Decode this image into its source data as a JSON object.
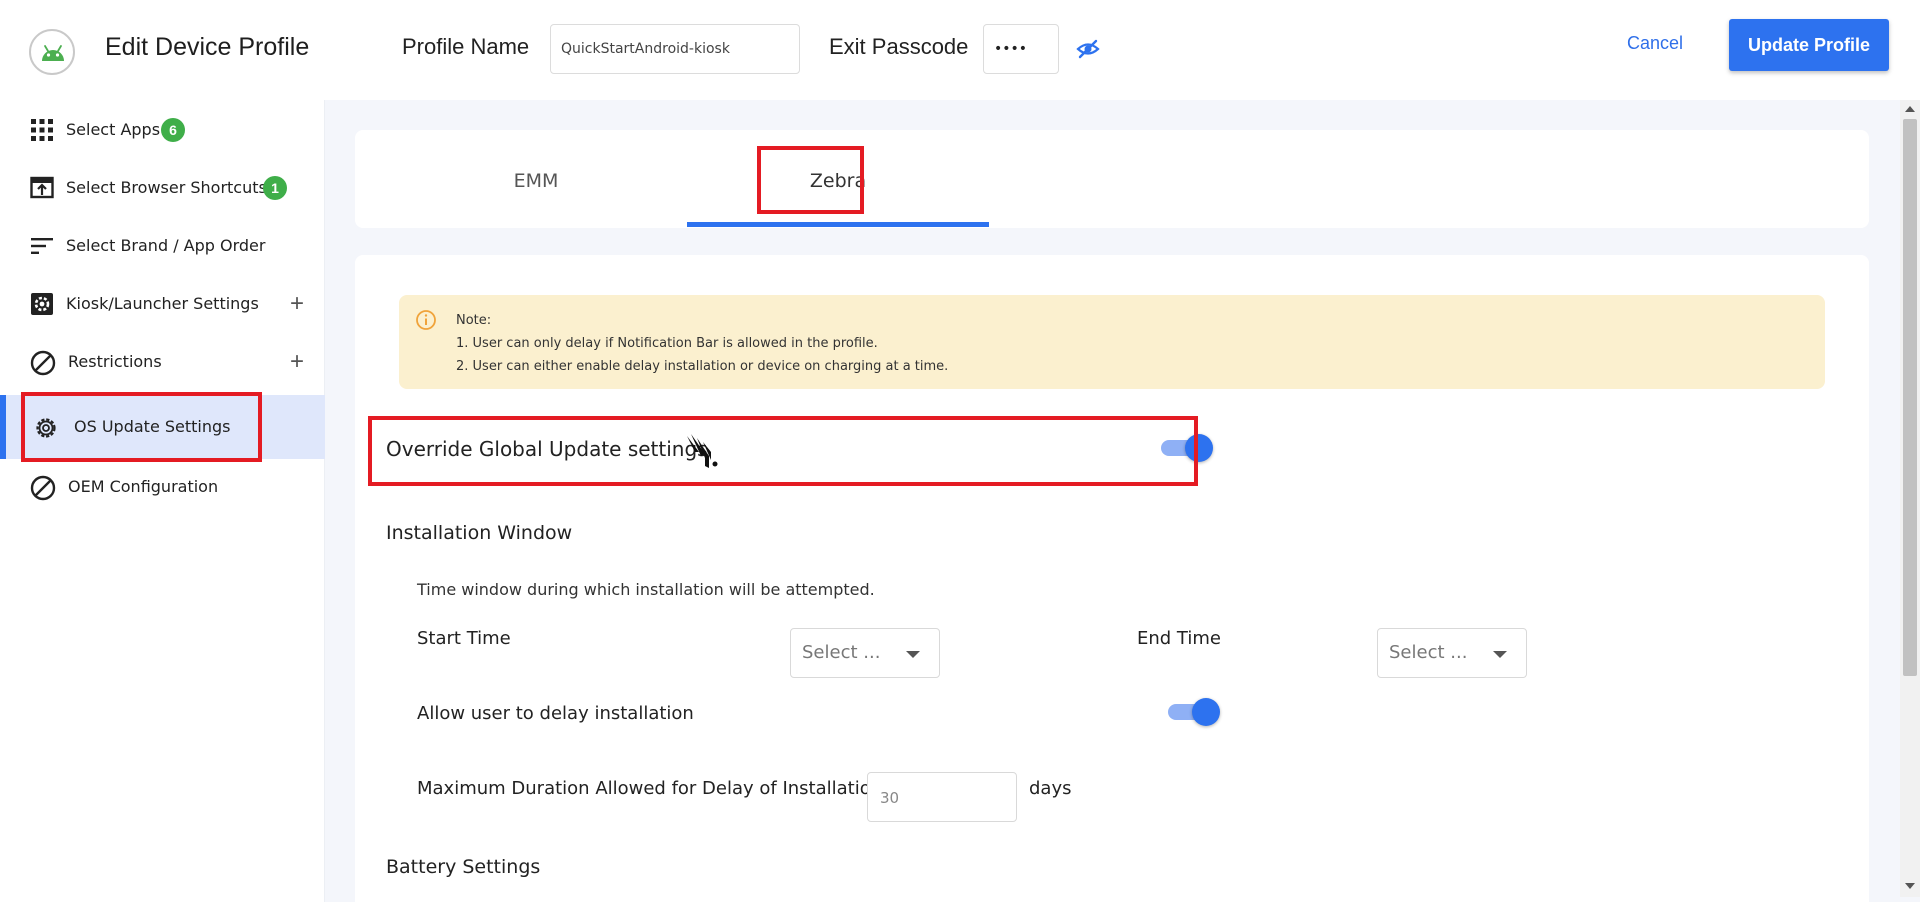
{
  "header": {
    "title": "Edit Device Profile",
    "profile_name_label": "Profile Name",
    "profile_name_value": "QuickStartAndroid-kiosk",
    "exit_passcode_label": "Exit Passcode",
    "exit_passcode_value": "••••",
    "cancel_label": "Cancel",
    "update_label": "Update Profile",
    "logo_icon": "android-icon",
    "accent_color": "#2d72ef"
  },
  "sidebar": {
    "items": [
      {
        "label": "Select Apps",
        "icon": "grid-icon",
        "badge": "6"
      },
      {
        "label": "Select Browser Shortcuts",
        "icon": "browser-shortcut-icon",
        "badge": "1"
      },
      {
        "label": "Select Brand / App Order",
        "icon": "sort-lines-icon"
      },
      {
        "label": "Kiosk/Launcher Settings",
        "icon": "kiosk-gear-icon",
        "expand": "+"
      },
      {
        "label": "Restrictions",
        "icon": "block-icon",
        "expand": "+"
      },
      {
        "label": "OS Update Settings",
        "icon": "gear-icon",
        "active": true
      },
      {
        "label": "OEM Configuration",
        "icon": "block-icon"
      }
    ],
    "badge_color": "#3fae49"
  },
  "tabs": [
    {
      "label": "EMM"
    },
    {
      "label": "Zebra",
      "active": true
    }
  ],
  "note": {
    "title": "Note:",
    "lines": [
      "1. User can only delay if Notification Bar is allowed in the profile.",
      "2. User can either enable delay installation or device on charging at a time."
    ],
    "icon": "info-icon",
    "bg_color": "#fbf0cf"
  },
  "override": {
    "label": "Override Global Update settings",
    "icon": "zebra-logo-icon",
    "enabled": true
  },
  "installation_window": {
    "title": "Installation Window",
    "description": "Time window during which installation will be attempted.",
    "start_time_label": "Start Time",
    "start_time_value": "Select ...",
    "end_time_label": "End Time",
    "end_time_value": "Select ...",
    "allow_delay_label": "Allow user to delay installation",
    "allow_delay_enabled": true,
    "max_duration_label": "Maximum Duration Allowed for Delay of Installation",
    "max_duration_value": "30",
    "max_duration_unit": "days"
  },
  "battery": {
    "title": "Battery Settings"
  }
}
